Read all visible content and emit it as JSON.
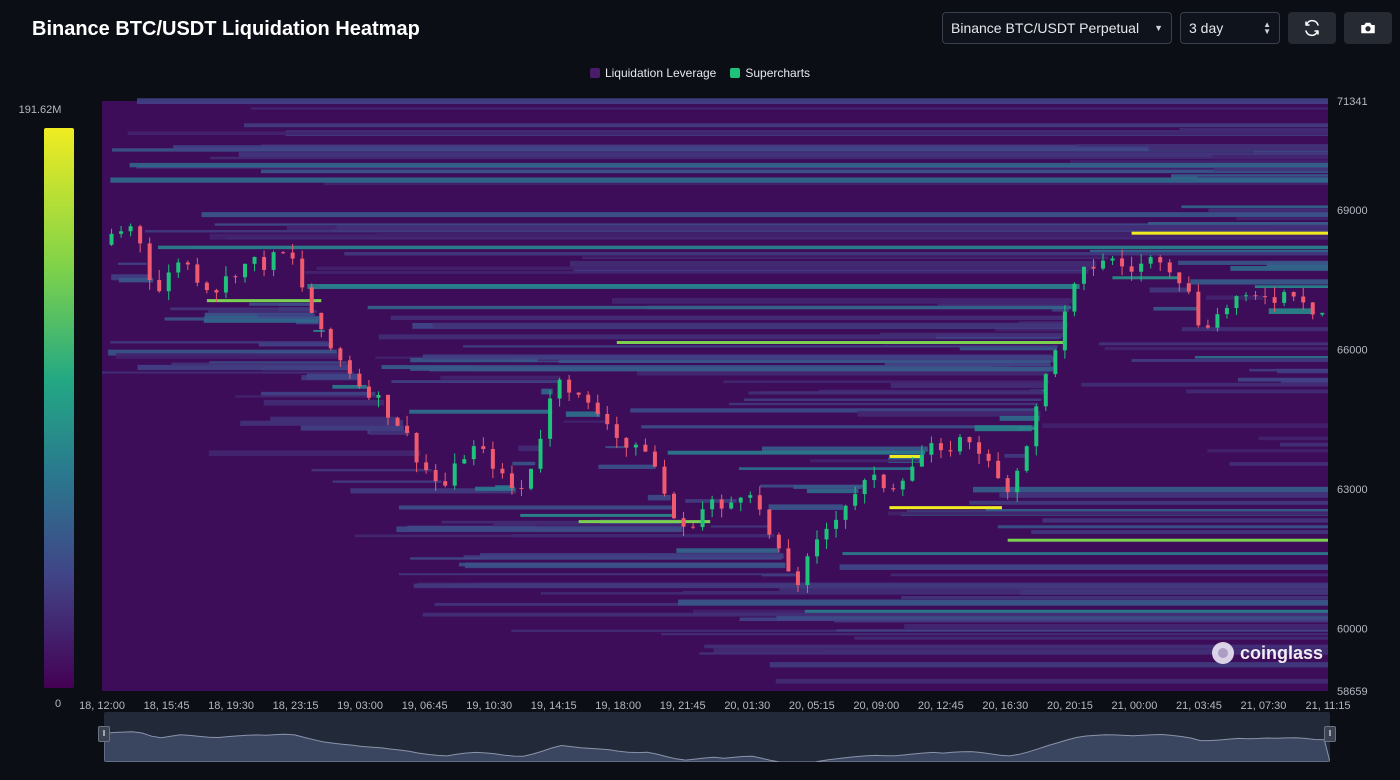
{
  "header": {
    "title": "Binance BTC/USDT Liquidation Heatmap",
    "pair_select": "Binance BTC/USDT Perpetual",
    "range_select": "3 day",
    "refresh_icon": "refresh-icon",
    "camera_icon": "camera-icon"
  },
  "legend": {
    "items": [
      {
        "label": "Liquidation Leverage",
        "color": "#4a1a6b"
      },
      {
        "label": "Supercharts",
        "color": "#1ec27a"
      }
    ]
  },
  "color_scale": {
    "max_label": "191.62M",
    "min_label": "0"
  },
  "watermark": "coinglass",
  "colors": {
    "background": "#0b0e14",
    "heat_low": "#440154",
    "heat_high": "#f0ec21",
    "candle_up": "#1ec27a",
    "candle_down": "#ef5a6f"
  },
  "chart_data": {
    "type": "heatmap",
    "title": "Binance BTC/USDT Liquidation Heatmap",
    "ylim": [
      58659,
      71341
    ],
    "y_ticks": [
      "71341",
      "69000",
      "66000",
      "63000",
      "60000",
      "58659"
    ],
    "y_tick_values": [
      71341,
      69000,
      66000,
      63000,
      60000,
      58659
    ],
    "x_ticks": [
      "18, 12:00",
      "18, 15:45",
      "18, 19:30",
      "18, 23:15",
      "19, 03:00",
      "19, 06:45",
      "19, 10:30",
      "19, 14:15",
      "19, 18:00",
      "19, 21:45",
      "20, 01:30",
      "20, 05:15",
      "20, 09:00",
      "20, 12:45",
      "20, 16:30",
      "20, 20:15",
      "21, 00:00",
      "21, 03:45",
      "21, 07:30",
      "21, 11:15"
    ],
    "price_path": [
      [
        0,
        68250
      ],
      [
        0.6,
        68500
      ],
      [
        1.3,
        68600
      ],
      [
        1.8,
        68700
      ],
      [
        2.3,
        67800
      ],
      [
        2.9,
        67200
      ],
      [
        3.5,
        67600
      ],
      [
        4.1,
        68000
      ],
      [
        4.7,
        67700
      ],
      [
        5.3,
        67400
      ],
      [
        6.0,
        67300
      ],
      [
        6.7,
        67600
      ],
      [
        7.4,
        67800
      ],
      [
        8.0,
        67900
      ],
      [
        8.6,
        67800
      ],
      [
        9.3,
        68100
      ],
      [
        10.0,
        67900
      ],
      [
        10.8,
        67000
      ],
      [
        11.5,
        66300
      ],
      [
        12.2,
        65900
      ],
      [
        12.9,
        65600
      ],
      [
        13.6,
        65200
      ],
      [
        14.4,
        65000
      ],
      [
        15.1,
        64600
      ],
      [
        15.8,
        64300
      ],
      [
        16.5,
        63700
      ],
      [
        17.2,
        63300
      ],
      [
        17.9,
        63000
      ],
      [
        18.6,
        63500
      ],
      [
        19.3,
        63900
      ],
      [
        19.9,
        63800
      ],
      [
        20.6,
        63500
      ],
      [
        21.2,
        63100
      ],
      [
        21.9,
        62900
      ],
      [
        22.6,
        63600
      ],
      [
        23.3,
        64600
      ],
      [
        23.9,
        65500
      ],
      [
        24.5,
        65200
      ],
      [
        25.1,
        64900
      ],
      [
        25.8,
        64700
      ],
      [
        26.5,
        64500
      ],
      [
        27.2,
        64000
      ],
      [
        27.8,
        63800
      ],
      [
        28.5,
        63900
      ],
      [
        29.2,
        63300
      ],
      [
        29.8,
        62500
      ],
      [
        30.5,
        62100
      ],
      [
        31.2,
        62400
      ],
      [
        31.9,
        62800
      ],
      [
        32.5,
        62500
      ],
      [
        33.2,
        62800
      ],
      [
        33.9,
        63100
      ],
      [
        34.6,
        62400
      ],
      [
        35.2,
        61800
      ],
      [
        35.9,
        61300
      ],
      [
        36.5,
        61000
      ],
      [
        37.2,
        61600
      ],
      [
        37.9,
        62100
      ],
      [
        38.6,
        62500
      ],
      [
        39.2,
        62800
      ],
      [
        39.9,
        63100
      ],
      [
        40.6,
        63200
      ],
      [
        41.3,
        63000
      ],
      [
        42.0,
        63300
      ],
      [
        42.7,
        63600
      ],
      [
        43.4,
        63900
      ],
      [
        44.0,
        63700
      ],
      [
        44.7,
        64000
      ],
      [
        45.4,
        64100
      ],
      [
        46.1,
        63800
      ],
      [
        46.8,
        63300
      ],
      [
        47.4,
        63000
      ],
      [
        48.1,
        63500
      ],
      [
        48.8,
        64400
      ],
      [
        49.4,
        65300
      ],
      [
        50.1,
        66200
      ],
      [
        50.7,
        67000
      ],
      [
        51.3,
        67600
      ],
      [
        52.0,
        67800
      ],
      [
        52.7,
        68000
      ],
      [
        53.4,
        67800
      ],
      [
        54.1,
        67700
      ],
      [
        54.8,
        67900
      ],
      [
        55.5,
        68000
      ],
      [
        56.2,
        67700
      ],
      [
        56.9,
        67300
      ],
      [
        57.5,
        66600
      ],
      [
        58.2,
        66600
      ],
      [
        58.9,
        66900
      ],
      [
        59.5,
        67100
      ],
      [
        60.2,
        67000
      ],
      [
        60.9,
        67200
      ],
      [
        61.6,
        67100
      ],
      [
        62.3,
        67300
      ],
      [
        63.0,
        67100
      ],
      [
        63.6,
        66800
      ],
      [
        64.3,
        66800
      ]
    ],
    "hot_levels": [
      {
        "price": 68500,
        "x_from": 54,
        "x_to": 64.3,
        "intensity": "high"
      },
      {
        "price": 63700,
        "x_from": 41.3,
        "x_to": 43.0,
        "intensity": "high"
      },
      {
        "price": 62600,
        "x_from": 41.3,
        "x_to": 47.2,
        "intensity": "high"
      },
      {
        "price": 66150,
        "x_from": 27.0,
        "x_to": 50.5,
        "intensity": "medium"
      },
      {
        "price": 62300,
        "x_from": 25.0,
        "x_to": 31.9,
        "intensity": "medium"
      },
      {
        "price": 67050,
        "x_from": 5.5,
        "x_to": 11.5,
        "intensity": "medium"
      },
      {
        "price": 61900,
        "x_from": 47.5,
        "x_to": 64.3,
        "intensity": "medium"
      }
    ]
  }
}
